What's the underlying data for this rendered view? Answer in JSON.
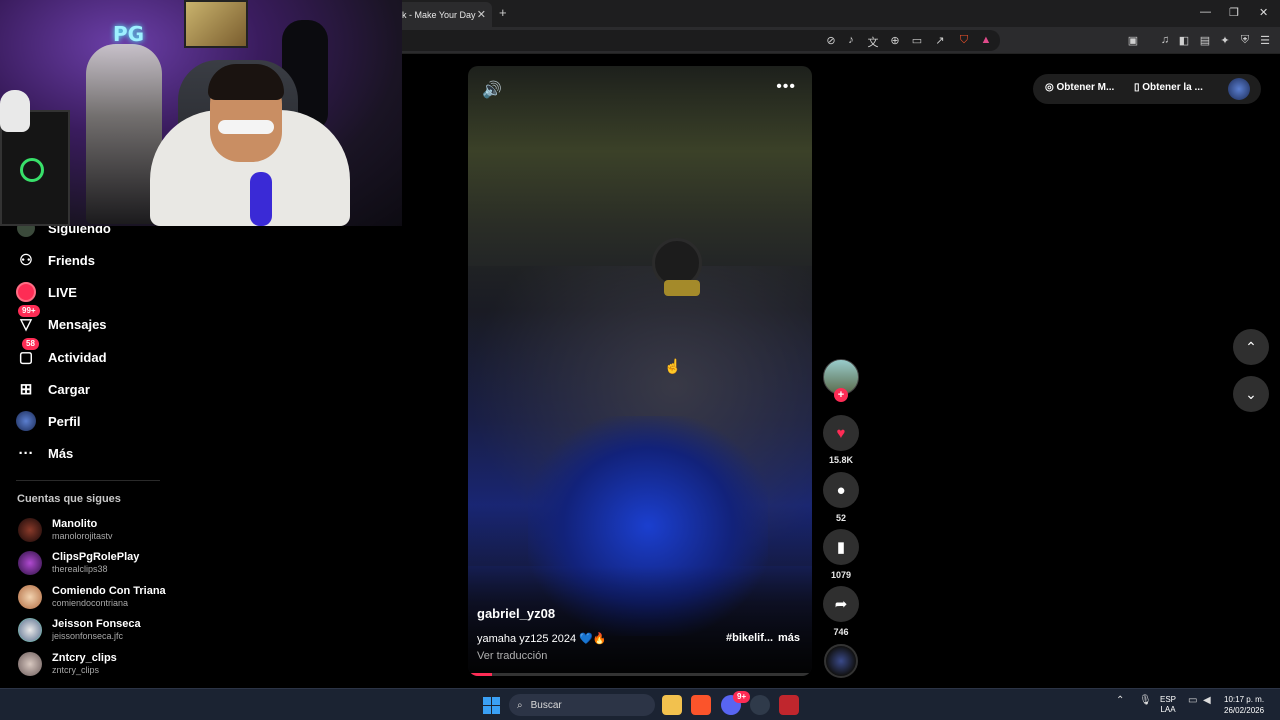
{
  "browser": {
    "tab_title": "k - Make Your Day",
    "tab_close": "✕",
    "new_tab": "+",
    "window_controls": {
      "minimize": "—",
      "restore": "❐",
      "close": "✕"
    }
  },
  "webcam": {
    "neon_text": "PG"
  },
  "sidebar": {
    "items": [
      {
        "label": "Siguiendo",
        "icon": "following-icon"
      },
      {
        "label": "Friends",
        "icon": "friends-icon"
      },
      {
        "label": "LIVE",
        "icon": "live-icon"
      },
      {
        "label": "Mensajes",
        "icon": "messages-icon",
        "badge": "99+"
      },
      {
        "label": "Actividad",
        "icon": "activity-icon",
        "badge": "58"
      },
      {
        "label": "Cargar",
        "icon": "upload-icon"
      },
      {
        "label": "Perfil",
        "icon": "profile-icon"
      },
      {
        "label": "Más",
        "icon": "more-icon"
      }
    ],
    "following_title": "Cuentas que sigues",
    "accounts": [
      {
        "name": "Manolito",
        "username": "manolorojitastv"
      },
      {
        "name": "ClipsPgRolePlay",
        "username": "therealclips38"
      },
      {
        "name": "Comiendo Con Triana",
        "username": "comiendocontriana"
      },
      {
        "name": "Jeisson Fonseca",
        "username": "jeissonfonseca.jfc"
      },
      {
        "name": "Zntcry_clips",
        "username": "zntcry_clips"
      }
    ]
  },
  "video": {
    "author": "gabriel_yz08",
    "caption": "yamaha yz125 2024 💙🔥",
    "hashtag": "#bikelif...",
    "more": "más",
    "translate": "Ver traducción",
    "progress_fraction": 0.07
  },
  "actions": {
    "likes": "15.8K",
    "comments": "52",
    "saves": "1079",
    "shares": "746"
  },
  "top_right": {
    "button1": "Obtener M...",
    "button2": "Obtener la ..."
  },
  "taskbar": {
    "search_placeholder": "Buscar",
    "language_line1": "ESP",
    "language_line2": "LAA",
    "time": "10:17 p. m.",
    "date": "26/02/2026",
    "discord_badge": "9+"
  },
  "colors": {
    "accent": "#fe2c55",
    "background": "#000000"
  }
}
